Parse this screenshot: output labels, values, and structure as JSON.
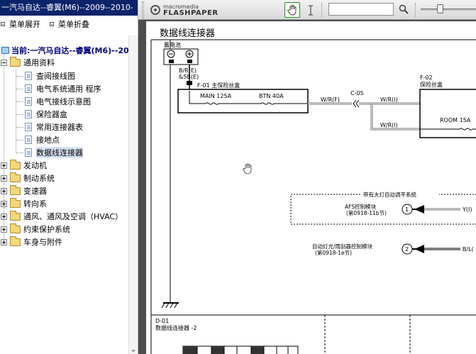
{
  "left_panel": {
    "title": "一汽马自达--睿翼(M6)--2009--2010-",
    "menu_expand": "菜单展开",
    "menu_collapse": "菜单折叠",
    "current": "当前:一汽马自达--睿翼(M6)--200",
    "tree": [
      {
        "label": "通用资料",
        "expanded": true,
        "children": [
          "查阅接线图",
          "电气系统通用 程序",
          "电气接线示意图",
          "保险器盒",
          "常用连接器表",
          "接地点",
          "数据线连接器"
        ]
      },
      {
        "label": "发动机"
      },
      {
        "label": "制动系统"
      },
      {
        "label": "变速器"
      },
      {
        "label": "转向系"
      },
      {
        "label": "通风、通风及空调（HVAC）"
      },
      {
        "label": "约束保护系统"
      },
      {
        "label": "车身与附件"
      }
    ],
    "selected_child": "数据线连接器"
  },
  "viewer": {
    "logo_top": "macromedia",
    "logo_bottom": "FLASHPAPER",
    "tools": {
      "hand": "hand-tool",
      "text": "text-select-tool"
    },
    "search_value": ""
  },
  "page": {
    "title": "数据线连接器",
    "labels": {
      "battery": "蓄电池",
      "bre": "B/R(E)",
      "b5": "&5B(E)",
      "f01": "F-01 主保险丝盒",
      "main": "MAIN 125A",
      "btn": "BTN 40A",
      "wrf": "W/R(F)",
      "c05": "C-05",
      "wri1": "W/R(I)",
      "wri2": "W/R(I)",
      "f02": "F-02",
      "f02b": "保险丝盒",
      "room": "ROOM 15A",
      "afs_sys": "带有大灯自动调平系统",
      "afs_mod": "AFS控制模块",
      "afs_sec": "(第0918-11b节)",
      "yl": "Y(I)",
      "auto_mod": "自动灯光/雨刮器控制模块",
      "auto_sec": "(第0918-1e节)",
      "bl": "B/L(",
      "pin1": "1",
      "pin2": "2",
      "d01": "D-01",
      "d01b": "数据线连接器 -2"
    }
  }
}
